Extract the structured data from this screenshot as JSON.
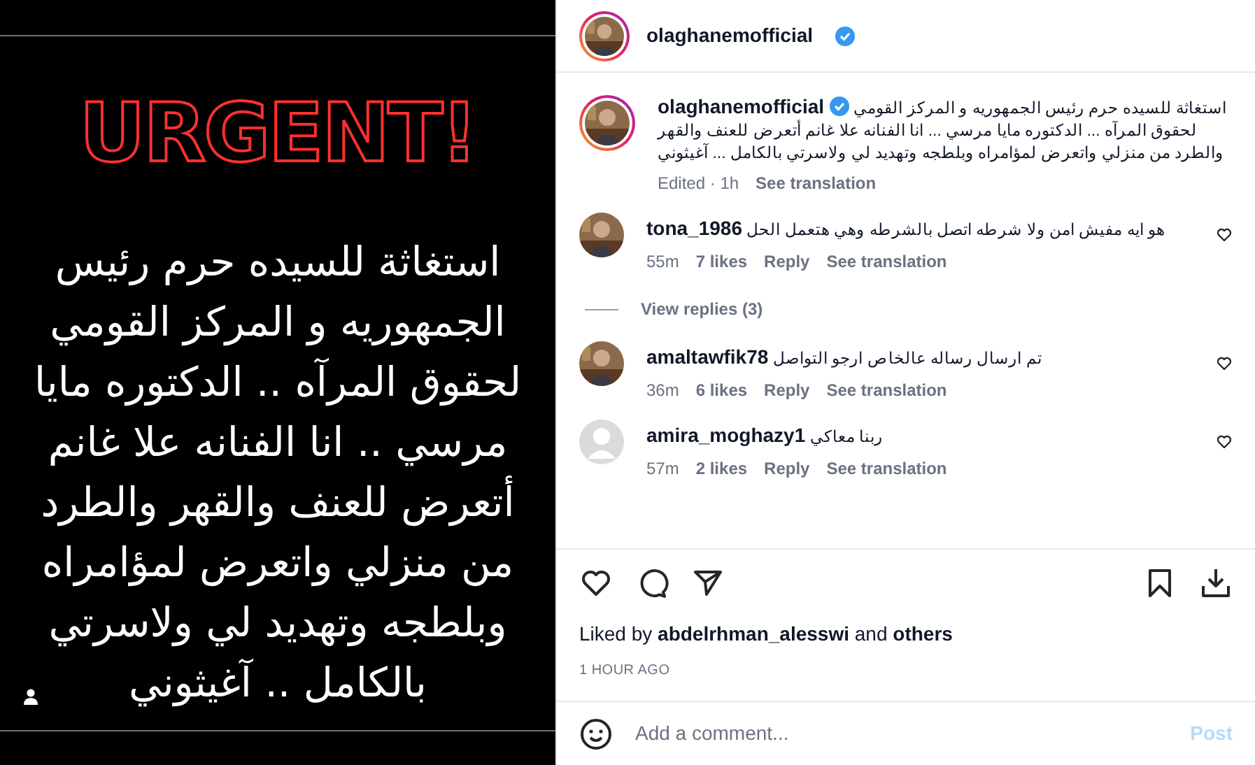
{
  "post_image": {
    "headline": "URGENT!",
    "lines": [
      "استغاثة للسيده حرم رئيس",
      "الجمهوريه و المركز القومي",
      "لحقوق المرآه .. الدكتوره مايا",
      "مرسي .. انا الفنانه علا غانم",
      "أتعرض للعنف والقهر والطرد",
      "من منزلي واتعرض لمؤامراه",
      "وبلطجه وتهديد لي ولاسرتي",
      "بالكامل .. آغيثوني"
    ]
  },
  "header": {
    "username": "olaghanemofficial",
    "verified": true
  },
  "caption": {
    "username": "olaghanemofficial",
    "verified": true,
    "text": "استغاثة للسيده حرم رئيس الجمهوريه و المركز القومي لحقوق المرآه ... الدكتوره مايا مرسي ... انا الفنانه علا غانم أتعرض للعنف والقهر والطرد من منزلي واتعرض لمؤامراه وبلطجه وتهديد لي ولاسرتي بالكامل ... آغيثوني",
    "edited": "Edited · 1h",
    "translate": "See translation"
  },
  "comments": [
    {
      "username": "tona_1986",
      "text": "هو ايه مفيش امن ولا شرطه اتصل بالشرطه وهي هتعمل الحل",
      "time": "55m",
      "likes": "7 likes",
      "reply": "Reply",
      "translate": "See translation",
      "view_replies": "View replies (3)"
    },
    {
      "username": "amaltawfik78",
      "text": "تم ارسال رساله عالخاص ارجو التواصل",
      "time": "36m",
      "likes": "6 likes",
      "reply": "Reply",
      "translate": "See translation"
    },
    {
      "kind": "placeholder",
      "username": "amira_moghazy1",
      "text": "ربنا معاكي",
      "time": "57m",
      "likes": "2 likes",
      "reply": "Reply",
      "translate": "See translation"
    }
  ],
  "liked_by": {
    "prefix": "Liked by",
    "user": "abdelrhman_alesswi",
    "joiner": "and",
    "others": "others"
  },
  "timestamp": "1 HOUR AGO",
  "comment_box": {
    "placeholder": "Add a comment...",
    "post": "Post",
    "disabled": true
  }
}
